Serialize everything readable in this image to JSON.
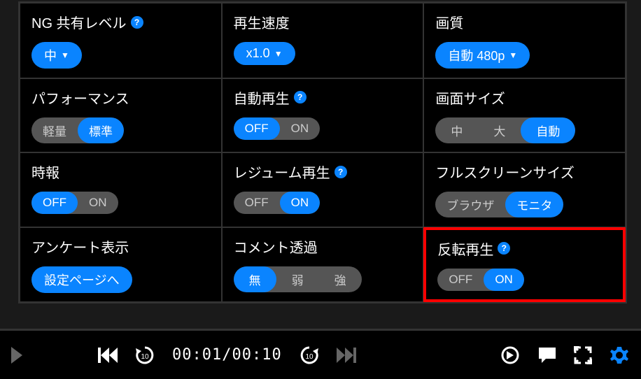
{
  "settings": {
    "ng_share": {
      "title": "NG 共有レベル",
      "value": "中",
      "help": "?"
    },
    "speed": {
      "title": "再生速度",
      "value": "x1.0"
    },
    "quality": {
      "title": "画質",
      "value": "自動 480p"
    },
    "performance": {
      "title": "パフォーマンス",
      "opts": [
        "軽量",
        "標準"
      ],
      "active": 1
    },
    "autoplay": {
      "title": "自動再生",
      "help": "?",
      "opts": [
        "OFF",
        "ON"
      ],
      "active": 0
    },
    "screen_size": {
      "title": "画面サイズ",
      "opts": [
        "中",
        "大",
        "自動"
      ],
      "active": 2
    },
    "chime": {
      "title": "時報",
      "opts": [
        "OFF",
        "ON"
      ],
      "active": 0
    },
    "resume": {
      "title": "レジューム再生",
      "help": "?",
      "opts": [
        "OFF",
        "ON"
      ],
      "active": 1
    },
    "fullscreen": {
      "title": "フルスクリーンサイズ",
      "opts": [
        "ブラウザ",
        "モニタ"
      ],
      "active": 1
    },
    "survey": {
      "title": "アンケート表示",
      "button": "設定ページへ"
    },
    "comment_alpha": {
      "title": "コメント透過",
      "opts": [
        "無",
        "弱",
        "強"
      ],
      "active": 0
    },
    "reverse": {
      "title": "反転再生",
      "help": "?",
      "opts": [
        "OFF",
        "ON"
      ],
      "active": 1
    }
  },
  "player": {
    "current": "00:01",
    "duration": "00:10"
  }
}
